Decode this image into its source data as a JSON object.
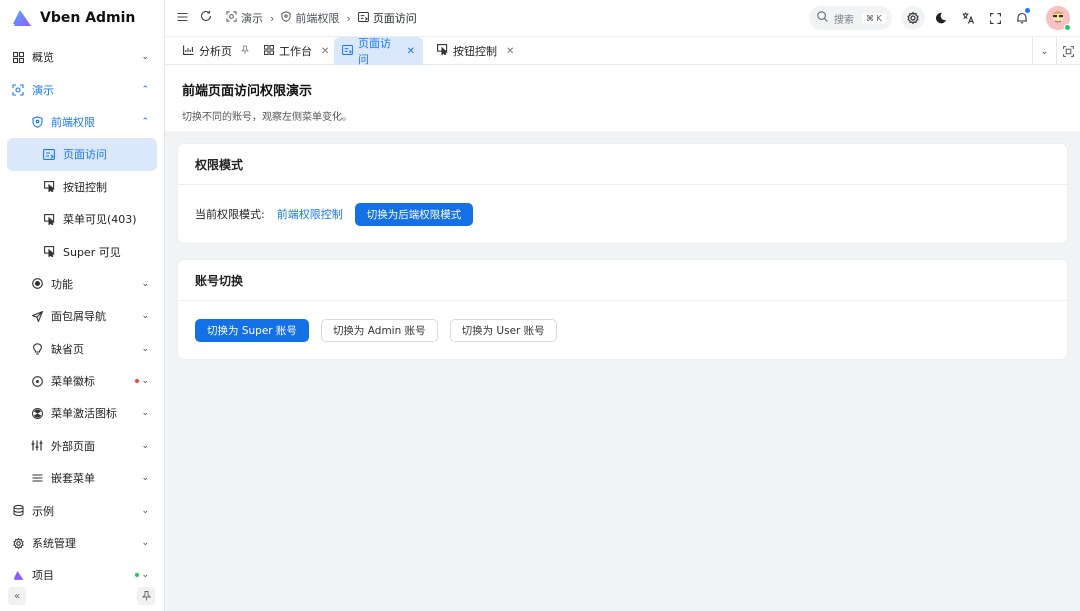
{
  "app": {
    "title": "Vben Admin"
  },
  "colors": {
    "accent": "#1677ff",
    "active_bg": "#dbe8fb",
    "dot_red": "#ef4444",
    "dot_green": "#22c55e"
  },
  "sidebar": {
    "items": [
      {
        "label": "概览",
        "icon": "dashboard-icon"
      },
      {
        "label": "演示",
        "icon": "scan-icon"
      },
      {
        "label": "前端权限",
        "icon": "shield-icon"
      },
      {
        "label": "页面访问",
        "icon": "page-access-icon"
      },
      {
        "label": "按钮控制",
        "icon": "pointer-icon"
      },
      {
        "label": "菜单可见(403)",
        "icon": "pointer-icon"
      },
      {
        "label": "Super 可见",
        "icon": "pointer-icon"
      },
      {
        "label": "功能",
        "icon": "circle-dot-icon"
      },
      {
        "label": "面包屑导航",
        "icon": "send-icon"
      },
      {
        "label": "缺省页",
        "icon": "bulb-icon"
      },
      {
        "label": "菜单徽标",
        "icon": "clock-icon"
      },
      {
        "label": "菜单激活图标",
        "icon": "radiation-icon"
      },
      {
        "label": "外部页面",
        "icon": "sliders-icon"
      },
      {
        "label": "嵌套菜单",
        "icon": "menu-icon"
      },
      {
        "label": "示例",
        "icon": "database-icon"
      },
      {
        "label": "系统管理",
        "icon": "gear-icon"
      },
      {
        "label": "项目",
        "icon": "vben-logo-icon"
      }
    ]
  },
  "header": {
    "breadcrumb": [
      "演示",
      "前端权限",
      "页面访问"
    ],
    "search": {
      "placeholder": "搜索",
      "shortcut": "⌘ K"
    }
  },
  "tabs": [
    {
      "label": "分析页"
    },
    {
      "label": "工作台"
    },
    {
      "label": "页面访问"
    },
    {
      "label": "按钮控制"
    }
  ],
  "page": {
    "title": "前端页面访问权限演示",
    "description": "切换不同的账号，观察左侧菜单变化。"
  },
  "permission_card": {
    "title": "权限模式",
    "current_label": "当前权限模式:",
    "current_value": "前端权限控制",
    "switch_button": "切换为后端权限模式"
  },
  "account_card": {
    "title": "账号切换",
    "buttons": [
      "切换为 Super 账号",
      "切换为 Admin 账号",
      "切换为 User 账号"
    ]
  }
}
